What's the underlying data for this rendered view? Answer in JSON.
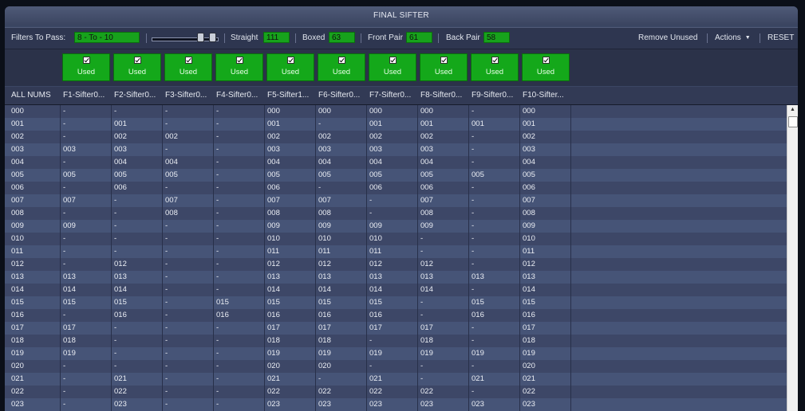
{
  "title": "FINAL SIFTER",
  "toolbar": {
    "filters_label": "Filters To Pass:",
    "filters_value": "8 - To - 10",
    "straight_label": "Straight",
    "straight_value": "111",
    "boxed_label": "Boxed",
    "boxed_value": "63",
    "front_label": "Front Pair",
    "front_value": "61",
    "back_label": "Back Pair",
    "back_value": "58",
    "remove_unused": "Remove Unused",
    "actions": "Actions",
    "reset": "RESET"
  },
  "checkbox_label": "Used",
  "columns": [
    "ALL NUMS",
    "F1-Sifter0...",
    "F2-Sifter0...",
    "F3-Sifter0...",
    "F4-Sifter0...",
    "F5-Sifter1...",
    "F6-Sifter0...",
    "F7-Sifter0...",
    "F8-Sifter0...",
    "F9-Sifter0...",
    "F10-Sifter..."
  ],
  "rows": [
    [
      "000",
      "-",
      "-",
      "-",
      "-",
      "000",
      "000",
      "000",
      "000",
      "-",
      "000"
    ],
    [
      "001",
      "-",
      "001",
      "-",
      "-",
      "001",
      "-",
      "001",
      "001",
      "001",
      "001"
    ],
    [
      "002",
      "-",
      "002",
      "002",
      "-",
      "002",
      "002",
      "002",
      "002",
      "-",
      "002"
    ],
    [
      "003",
      "003",
      "003",
      "-",
      "-",
      "003",
      "003",
      "003",
      "003",
      "-",
      "003"
    ],
    [
      "004",
      "-",
      "004",
      "004",
      "-",
      "004",
      "004",
      "004",
      "004",
      "-",
      "004"
    ],
    [
      "005",
      "005",
      "005",
      "005",
      "-",
      "005",
      "005",
      "005",
      "005",
      "005",
      "005"
    ],
    [
      "006",
      "-",
      "006",
      "-",
      "-",
      "006",
      "-",
      "006",
      "006",
      "-",
      "006"
    ],
    [
      "007",
      "007",
      "-",
      "007",
      "-",
      "007",
      "007",
      "-",
      "007",
      "-",
      "007"
    ],
    [
      "008",
      "-",
      "-",
      "008",
      "-",
      "008",
      "008",
      "-",
      "008",
      "-",
      "008"
    ],
    [
      "009",
      "009",
      "-",
      "-",
      "-",
      "009",
      "009",
      "009",
      "009",
      "-",
      "009"
    ],
    [
      "010",
      "-",
      "-",
      "-",
      "-",
      "010",
      "010",
      "010",
      "-",
      "-",
      "010"
    ],
    [
      "011",
      "-",
      "-",
      "-",
      "-",
      "011",
      "011",
      "011",
      "-",
      "-",
      "011"
    ],
    [
      "012",
      "-",
      "012",
      "-",
      "-",
      "012",
      "012",
      "012",
      "012",
      "-",
      "012"
    ],
    [
      "013",
      "013",
      "013",
      "-",
      "-",
      "013",
      "013",
      "013",
      "013",
      "013",
      "013"
    ],
    [
      "014",
      "014",
      "014",
      "-",
      "-",
      "014",
      "014",
      "014",
      "014",
      "-",
      "014"
    ],
    [
      "015",
      "015",
      "015",
      "-",
      "015",
      "015",
      "015",
      "015",
      "-",
      "015",
      "015"
    ],
    [
      "016",
      "-",
      "016",
      "-",
      "016",
      "016",
      "016",
      "016",
      "-",
      "016",
      "016"
    ],
    [
      "017",
      "017",
      "-",
      "-",
      "-",
      "017",
      "017",
      "017",
      "017",
      "-",
      "017"
    ],
    [
      "018",
      "018",
      "-",
      "-",
      "-",
      "018",
      "018",
      "-",
      "018",
      "-",
      "018"
    ],
    [
      "019",
      "019",
      "-",
      "-",
      "-",
      "019",
      "019",
      "019",
      "019",
      "019",
      "019"
    ],
    [
      "020",
      "-",
      "-",
      "-",
      "-",
      "020",
      "020",
      "-",
      "-",
      "-",
      "020"
    ],
    [
      "021",
      "-",
      "021",
      "-",
      "-",
      "021",
      "-",
      "021",
      "-",
      "021",
      "021"
    ],
    [
      "022",
      "-",
      "022",
      "-",
      "-",
      "022",
      "022",
      "022",
      "022",
      "-",
      "022"
    ],
    [
      "023",
      "-",
      "023",
      "-",
      "-",
      "023",
      "023",
      "023",
      "023",
      "023",
      "023"
    ]
  ]
}
